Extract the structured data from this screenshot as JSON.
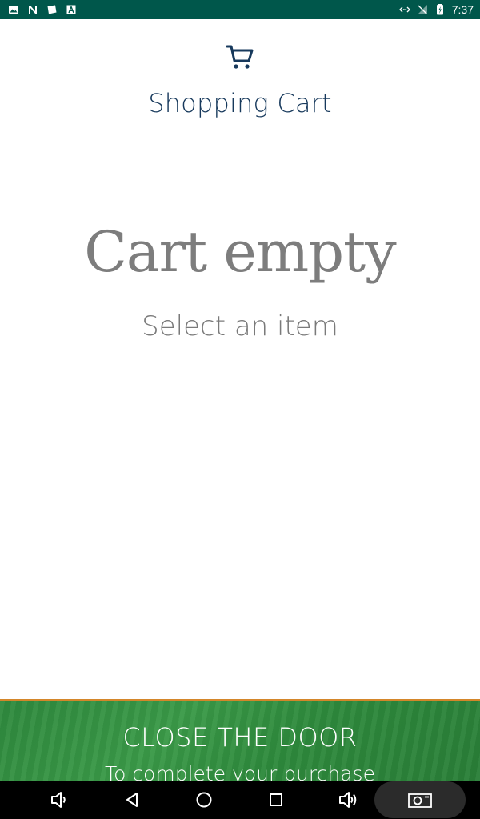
{
  "status_bar": {
    "time": "7:37",
    "left_icons": [
      "gallery-icon",
      "n-app-icon",
      "note-icon",
      "a-app-icon"
    ],
    "right_icons": [
      "data-transfer-icon",
      "no-signal-icon",
      "battery-charging-icon"
    ]
  },
  "header": {
    "icon": "cart-icon",
    "title": "Shopping Cart"
  },
  "empty_state": {
    "heading": "Cart empty",
    "subtitle": "Select an item"
  },
  "banner": {
    "title": "CLOSE THE DOOR",
    "subtitle": "To complete your purchase",
    "accent_color": "#d4862a",
    "background_color": "#2f8a3e"
  },
  "nav_bar": {
    "buttons": [
      "volume-down-icon",
      "back-icon",
      "home-icon",
      "recents-icon",
      "volume-up-icon",
      "screenshot-icon"
    ]
  },
  "colors": {
    "status_bar": "#00574b",
    "title": "#17395c",
    "muted_text": "#7d7d7d"
  }
}
